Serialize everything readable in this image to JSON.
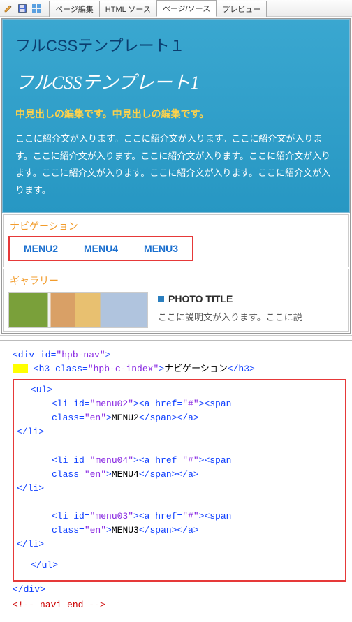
{
  "toolbar": {
    "tabs": {
      "page_edit": "ページ編集",
      "html_source": "HTML ソース",
      "page_source": "ページ/ソース",
      "preview": "プレビュー"
    },
    "icons": {
      "pencil": "pencil-icon",
      "disk": "disk-icon",
      "grid": "grid-icon"
    }
  },
  "banner": {
    "brand1": "フルCSSテンプレート１",
    "brand2": "フルCSSテンプレート1",
    "sub": "中見出しの編集です。中見出しの編集です。",
    "para": "ここに紹介文が入ります。ここに紹介文が入ります。ここに紹介文が入ります。ここに紹介文が入ります。ここに紹介文が入ります。ここに紹介文が入ります。ここに紹介文が入ります。ここに紹介文が入ります。ここに紹介文が入ります。"
  },
  "nav": {
    "title": "ナビゲーション",
    "items": [
      "MENU2",
      "MENU4",
      "MENU3"
    ]
  },
  "gallery": {
    "title": "ギャラリー",
    "photo_title": "PHOTO TITLE",
    "photo_desc": "ここに説明文が入ります。ここに説"
  },
  "source": {
    "line1_open": "<div id=",
    "line1_attr": "\"hpb-nav\"",
    "line1_close": ">",
    "h3_open": "<h3 class=",
    "h3_attr": "\"hpb-c-index\"",
    "h3_mid": ">",
    "h3_text": "ナビゲーション",
    "h3_close": "</h3>",
    "ul_open": "<ul>",
    "li_open": "<li id=",
    "li_ids": [
      "\"menu02\"",
      "\"menu04\"",
      "\"menu03\""
    ],
    "li_mid1": "><a href=",
    "href_val": "\"#\"",
    "li_mid2": "><span class=",
    "span_class": "\"en\"",
    "li_mid3": ">",
    "li_texts": [
      "MENU2",
      "MENU4",
      "MENU3"
    ],
    "span_close": "</span>",
    "a_close": "</a>",
    "li_close": "</li>",
    "ul_close": "</ul>",
    "div_close": "</div>",
    "comment": "<!-- navi end -->"
  }
}
